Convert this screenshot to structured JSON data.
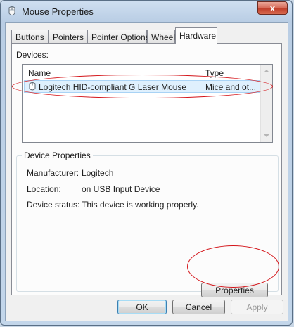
{
  "window": {
    "title": "Mouse Properties",
    "close_glyph": "x"
  },
  "tabs": [
    {
      "label": "Buttons"
    },
    {
      "label": "Pointers"
    },
    {
      "label": "Pointer Options"
    },
    {
      "label": "Wheel"
    },
    {
      "label": "Hardware",
      "selected": true
    }
  ],
  "devices": {
    "label": "Devices:",
    "columns": {
      "name": "Name",
      "type": "Type"
    },
    "rows": [
      {
        "name": "Logitech HID-compliant G Laser Mouse",
        "type": "Mice and ot...",
        "selected": true
      }
    ]
  },
  "device_properties": {
    "title": "Device Properties",
    "manufacturer_label": "Manufacturer:",
    "manufacturer_value": "Logitech",
    "location_label": "Location:",
    "location_value": "on USB Input Device",
    "status_label": "Device status:",
    "status_value": "This device is working properly.",
    "properties_button": "Properties"
  },
  "buttons": {
    "ok": "OK",
    "cancel": "Cancel",
    "apply": "Apply"
  },
  "annotation_color": "#d4161b",
  "icons": {
    "app": "mouse-icon",
    "device": "mouse-device-icon",
    "close": "close-icon"
  }
}
